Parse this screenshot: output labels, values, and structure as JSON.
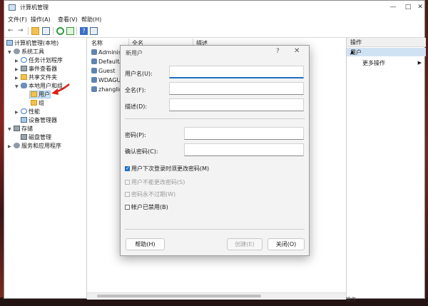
{
  "window": {
    "title": "计算机管理"
  },
  "menu": [
    "文件(F)",
    "操作(A)",
    "查看(V)",
    "帮助(H)"
  ],
  "tree": {
    "root": "计算机管理(本地)",
    "system_tools": "系统工具",
    "task_scheduler": "任务计划程序",
    "event_viewer": "事件查看器",
    "shared_folders": "共享文件夹",
    "local_users_groups": "本地用户和组",
    "users": "用户",
    "groups": "组",
    "performance": "性能",
    "device_manager": "设备管理器",
    "storage": "存储",
    "disk_management": "磁盘管理",
    "services_apps": "服务和应用程序"
  },
  "list": {
    "columns": [
      "名称",
      "全名",
      "描述"
    ],
    "rows": [
      "Administr",
      "DefaultAc",
      "Guest",
      "WDAGUtil",
      "zhanglin"
    ]
  },
  "actions": {
    "header": "操作",
    "section": "用户",
    "more": "更多操作"
  },
  "dialog": {
    "title": "新用户",
    "help_glyph": "?",
    "close_glyph": "✕",
    "username_label": "用户名(U):",
    "fullname_label": "全名(F):",
    "description_label": "描述(D):",
    "password_label": "密码(P):",
    "confirm_label": "确认密码(C):",
    "chk_change_next": "用户下次登录时须更改密码(M)",
    "chk_cannot_change": "用户不能更改密码(S)",
    "chk_never_expires": "密码永不过期(W)",
    "chk_disabled": "帐户已禁用(B)",
    "btn_help": "帮助(H)",
    "btn_create": "创建(E)",
    "btn_close": "关闭(O)"
  },
  "status_text": "操作"
}
